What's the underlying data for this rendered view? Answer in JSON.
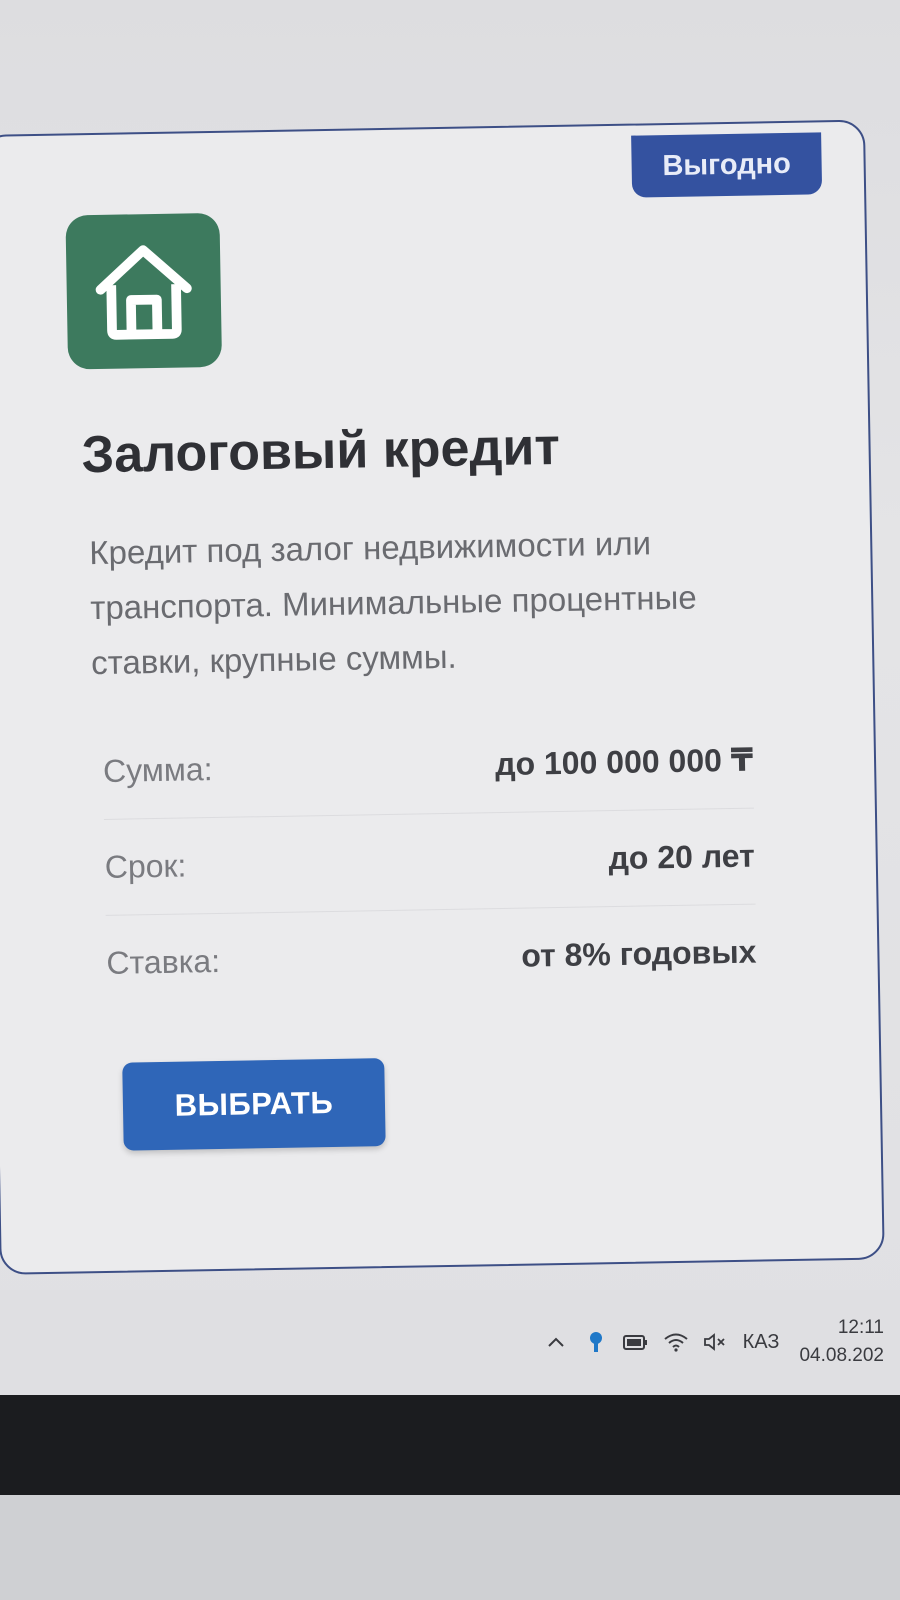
{
  "card": {
    "badge": "Выгодно",
    "title": "Залоговый кредит",
    "description": "Кредит под залог недвижимости или транспорта. Минимальные процентные ставки, крупные суммы.",
    "details": [
      {
        "label": "Сумма:",
        "value": "до 100 000 000 ₸"
      },
      {
        "label": "Срок:",
        "value": "до 20 лет"
      },
      {
        "label": "Ставка:",
        "value": "от 8% годовых"
      }
    ],
    "select_button": "ВЫБРАТЬ",
    "logo_icon": "house-icon",
    "logo_color": "#3d7a5e",
    "accent_color": "#2f66b8",
    "badge_color": "#3452a0"
  },
  "taskbar": {
    "language": "КАЗ",
    "time": "12:11",
    "date": "04.08.202",
    "tray_icons": [
      "chevron-up-icon",
      "security-icon",
      "battery-icon",
      "wifi-icon",
      "volume-muted-icon"
    ]
  }
}
